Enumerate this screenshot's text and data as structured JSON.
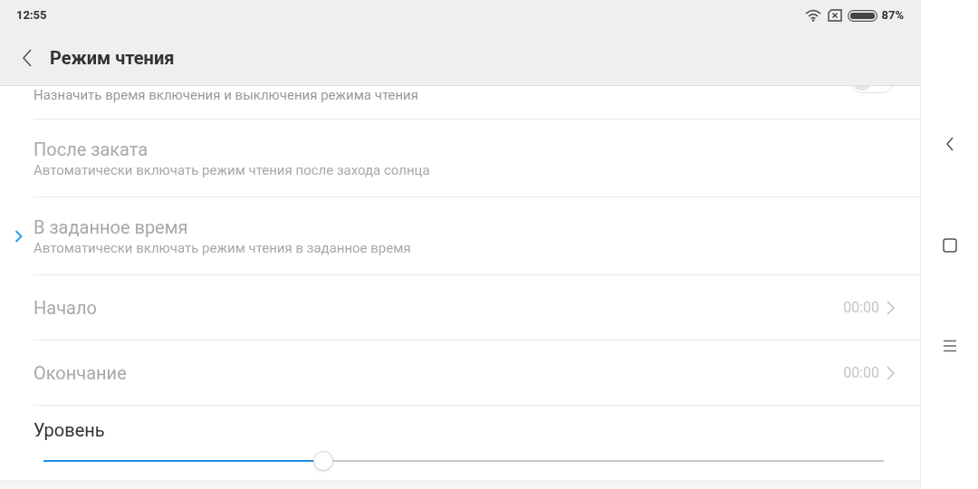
{
  "status_bar": {
    "time": "12:55",
    "battery": "87%"
  },
  "header": {
    "title": "Режим чтения"
  },
  "schedule": {
    "subtitle": "Назначить время включения и выключения режима чтения",
    "on": false
  },
  "modes": [
    {
      "title": "После заката",
      "subtitle": "Автоматически включать режим чтения после захода солнца",
      "selected": false,
      "disabled": true
    },
    {
      "title": "В заданное время",
      "subtitle": "Автоматически включать режим чтения в заданное время",
      "selected": true,
      "disabled": true
    }
  ],
  "times": [
    {
      "label": "Начало",
      "value": "00:00",
      "disabled": true
    },
    {
      "label": "Окончание",
      "value": "00:00",
      "disabled": true
    }
  ],
  "level": {
    "label": "Уровень",
    "level": 0.333
  }
}
